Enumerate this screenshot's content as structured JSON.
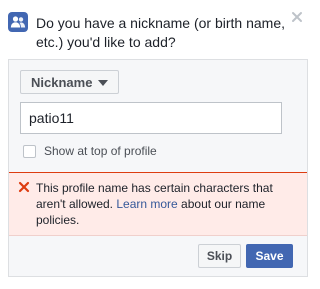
{
  "header": {
    "prompt": "Do you have a nickname (or birth name, etc.) you'd like to add?"
  },
  "form": {
    "name_type_select": "Nickname",
    "name_input_value": "patio11",
    "show_at_top_label": "Show at top of profile"
  },
  "error": {
    "text_before_link": "This profile name has certain characters that aren't allowed. ",
    "link_text": "Learn more",
    "text_after_link": " about our name policies."
  },
  "actions": {
    "skip_label": "Skip",
    "save_label": "Save"
  },
  "colors": {
    "brand_blue": "#4267b2",
    "error_background": "#ffebe8",
    "error_icon": "#dd3c10",
    "link": "#365899"
  },
  "icons": {
    "header": "people-icon",
    "close": "close-icon",
    "select": "chevron-down-icon",
    "error": "error-x-icon"
  }
}
